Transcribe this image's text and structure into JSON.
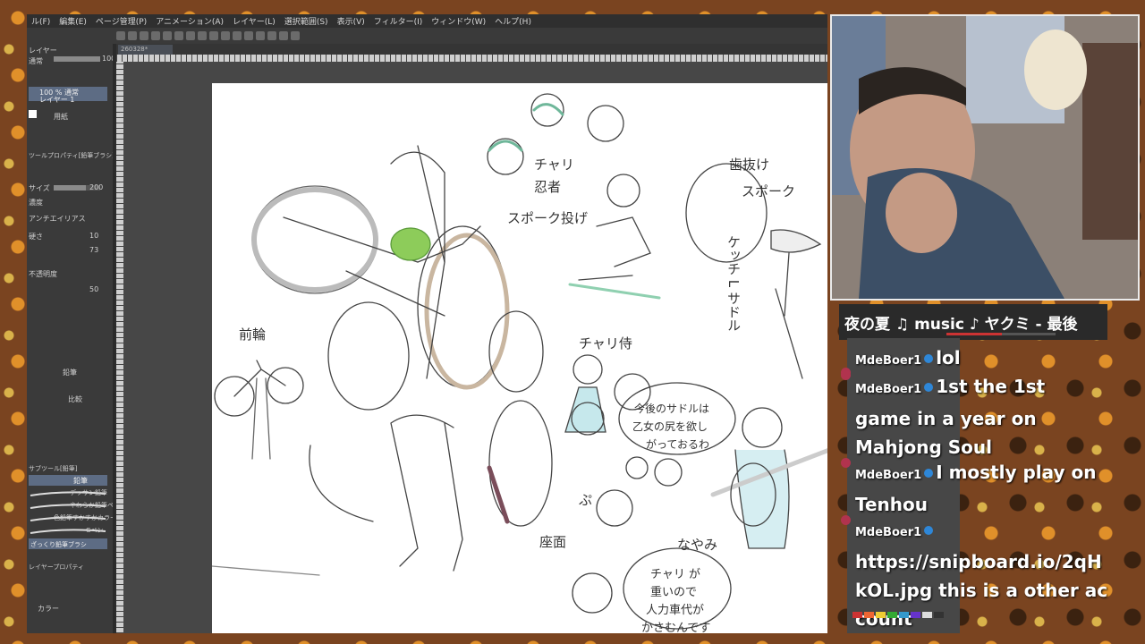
{
  "menubar": {
    "items": [
      "ル(F)",
      "編集(E)",
      "ページ管理(P)",
      "アニメーション(A)",
      "レイヤー(L)",
      "選択範囲(S)",
      "表示(V)",
      "フィルター(I)",
      "ウィンドウ(W)",
      "ヘルプ(H)"
    ]
  },
  "document": {
    "tab_label": "260328*"
  },
  "left_panel": {
    "layer_header": "レイヤー",
    "blend_mode": "通常",
    "opacity": "100",
    "layer_item_line1": "100 % 通常",
    "layer_item_line2": "レイヤー 1",
    "paper_label": "用紙",
    "tool_property": "ツールプロパティ[鉛筆ブラシ]",
    "size_label": "サイズ",
    "size_value": "200",
    "density_label": "濃度",
    "antialias_label": "アンチエイリアス",
    "hardness_label": "硬さ",
    "hardness_value": "10",
    "density_value": "73",
    "opacity_label": "不透明度",
    "opacity_value": "50",
    "pencil_label": "鉛筆",
    "comp_label": "比較",
    "sub_tool": "サブツール[鉛筆]",
    "brush_pencil": "鉛筆",
    "brush_items": [
      "デッサン鉛筆",
      "やわらか鉛筆ペン",
      "色鉛筆すかすかカラー",
      "Gペン",
      "ざっくり鉛筆ブラシ"
    ],
    "layer_prop": "レイヤープロパティ",
    "color_label": "カラー"
  },
  "canvas_notes": {
    "ninja_1": "チャリ",
    "ninja_2": "忍者",
    "spoke_throw": "スポーク投げ",
    "fan_1": "歯抜け",
    "fan_2": "スポーク",
    "kettle": "ケッチ L サドル",
    "front_wheel": "前輪",
    "samurai": "チャリ侍",
    "note1": "今後のサドルは",
    "note2": "乙女の尻を欲し",
    "note3": "がっておるわ",
    "wind": "ぷ",
    "seat": "座面",
    "nayami": "なやみ",
    "bubble1": "チャリ が",
    "bubble2": "重いので",
    "bubble3": "人力車代が",
    "bubble4": "かさむんです"
  },
  "music": {
    "now_playing": "夜の夏  ♫ music ♪ ヤクミ - 最後"
  },
  "chat": {
    "messages": [
      {
        "user": "MdeBoer1",
        "text": "lol"
      },
      {
        "user": "MdeBoer1",
        "text": "1st the 1st game in a year on Mahjong Soul"
      },
      {
        "user": "MdeBoer1",
        "text": "I mostly play on Tenhou"
      },
      {
        "user": "MdeBoer1",
        "text": "https://snipboard.io/2qHkOL.jpg this is a other account"
      }
    ]
  },
  "colors": {
    "frame": "#7a4420",
    "app_bg": "#4b4b4b",
    "selected_layer": "#5d6c84",
    "mod_icon": "#2e87d8",
    "badge": "#b1334e"
  }
}
